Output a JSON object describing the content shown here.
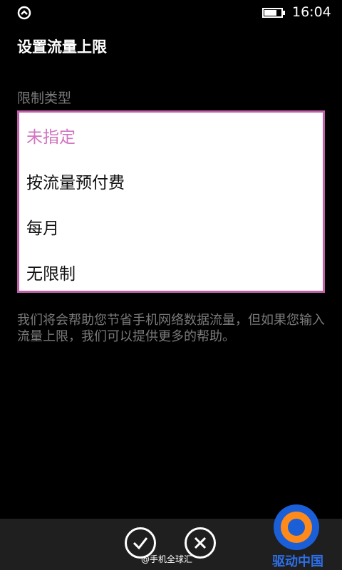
{
  "status_bar": {
    "time": "16:04",
    "left_icon": "data-sense-icon",
    "battery_icon": "battery-icon"
  },
  "page": {
    "title": "设置流量上限",
    "field_label": "限制类型"
  },
  "options": [
    {
      "label": "未指定",
      "selected": true
    },
    {
      "label": "按流量预付费",
      "selected": false
    },
    {
      "label": "每月",
      "selected": false
    },
    {
      "label": "无限制",
      "selected": false
    }
  ],
  "help_text": "我们将会帮助您节省手机网络数据流量，但如果您输入流量上限，我们可以提供更多的帮助。",
  "app_bar": {
    "confirm_icon": "checkmark-icon",
    "cancel_icon": "close-icon"
  },
  "watermarks": {
    "weibo": "@手机全球汇",
    "logo": "驱动中国"
  },
  "colors": {
    "accent": "#d175c0",
    "border": "#c060a8",
    "secondary_text": "#7a7a7a"
  }
}
